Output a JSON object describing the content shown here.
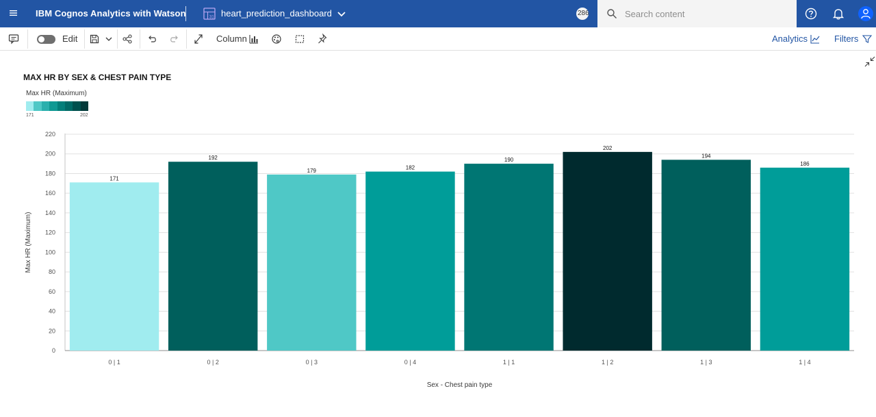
{
  "header": {
    "app_title": "IBM Cognos Analytics with Watson",
    "dashboard_name": "heart_prediction_dashboard",
    "notification_badge": "286",
    "search_placeholder": "Search content",
    "icons": [
      "menu-icon",
      "dashboard-icon",
      "chevron-down-icon",
      "search-icon",
      "help-icon",
      "notifications-icon",
      "user-icon"
    ]
  },
  "toolbar": {
    "edit_label": "Edit",
    "visualization_type_label": "Column",
    "analytics_label": "Analytics",
    "filters_label": "Filters",
    "icons": [
      "comment-icon",
      "edit-toggle",
      "save-icon",
      "chevron-down-icon",
      "share-icon",
      "undo-icon",
      "redo-icon",
      "expand-icon",
      "column-chart-icon",
      "palette-icon",
      "select-region-icon",
      "pin-icon",
      "analytics-chart-icon",
      "filter-icon"
    ]
  },
  "legend": {
    "title": "Max HR (Maximum)",
    "min_label": "171",
    "max_label": "202",
    "colors": [
      "#a0ecef",
      "#4fc8c6",
      "#2bb0ad",
      "#0f9993",
      "#037f7a",
      "#006a66",
      "#00504e",
      "#033a3a"
    ]
  },
  "chart_data": {
    "type": "bar",
    "title": "MAX HR BY SEX & CHEST PAIN TYPE",
    "xlabel": "Sex - Chest pain type",
    "ylabel": "Max HR (Maximum)",
    "ylim": [
      0,
      220
    ],
    "yticks": [
      0,
      20,
      40,
      60,
      80,
      100,
      120,
      140,
      160,
      180,
      200,
      220
    ],
    "grid": true,
    "categories": [
      "0 | 1",
      "0 | 2",
      "0 | 3",
      "0 | 4",
      "1 | 1",
      "1 | 2",
      "1 | 3",
      "1 | 4"
    ],
    "values": [
      171,
      192,
      179,
      182,
      190,
      202,
      194,
      186
    ],
    "data_labels": [
      "171",
      "192",
      "179",
      "182",
      "190",
      "202",
      "194",
      "186"
    ],
    "colors": [
      "#a0ecef",
      "#005f5c",
      "#4fc8c6",
      "#009d99",
      "#007673",
      "#002a2e",
      "#005f5c",
      "#009d99"
    ]
  }
}
